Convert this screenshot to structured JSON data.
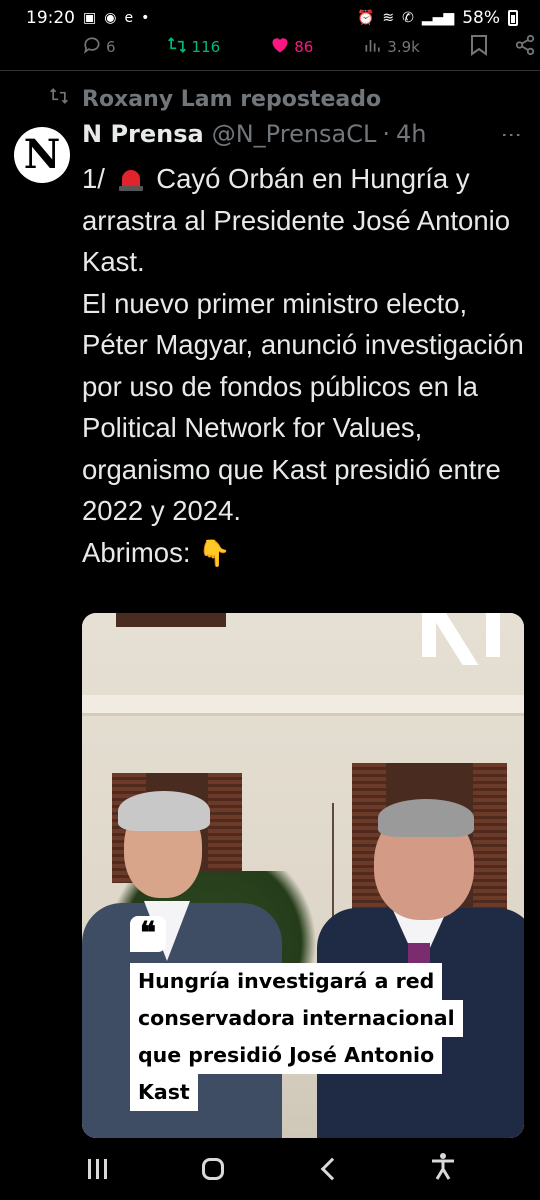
{
  "status_bar": {
    "time": "19:20",
    "battery": "58%"
  },
  "action_bar": {
    "replies": "6",
    "reposts": "116",
    "likes": "86",
    "views": "3.9k",
    "colors": {
      "repost": "#00ba7c",
      "like": "#f91880",
      "muted": "#71767b"
    }
  },
  "repost_notice": {
    "text": "Roxany Lam reposteado",
    "icon": "repost-icon"
  },
  "tweet": {
    "avatar_letter": "N",
    "author_name": "N Prensa",
    "handle": "@N_PrensaCL",
    "separator": "·",
    "time": "4h",
    "text": {
      "line1_prefix": "1/",
      "line1_rest": "Cayó Orbán en Hungría y arrastra al Presidente José Antonio Kast.",
      "paragraph2": "El nuevo primer ministro electo, Péter Magyar, anunció investigación por uso de fondos públicos en la Political Network for Values, organismo que Kast presidió entre 2022 y 2024.",
      "paragraph3": "Abrimos:"
    },
    "media": {
      "caption_lines": [
        "Hungría investigará a red",
        "conservadora internacional",
        "que presidió José Antonio",
        "Kast"
      ]
    }
  },
  "nav_bar": {
    "icons": [
      "recent-apps-icon",
      "home-icon",
      "back-icon",
      "accessibility-icon"
    ]
  }
}
